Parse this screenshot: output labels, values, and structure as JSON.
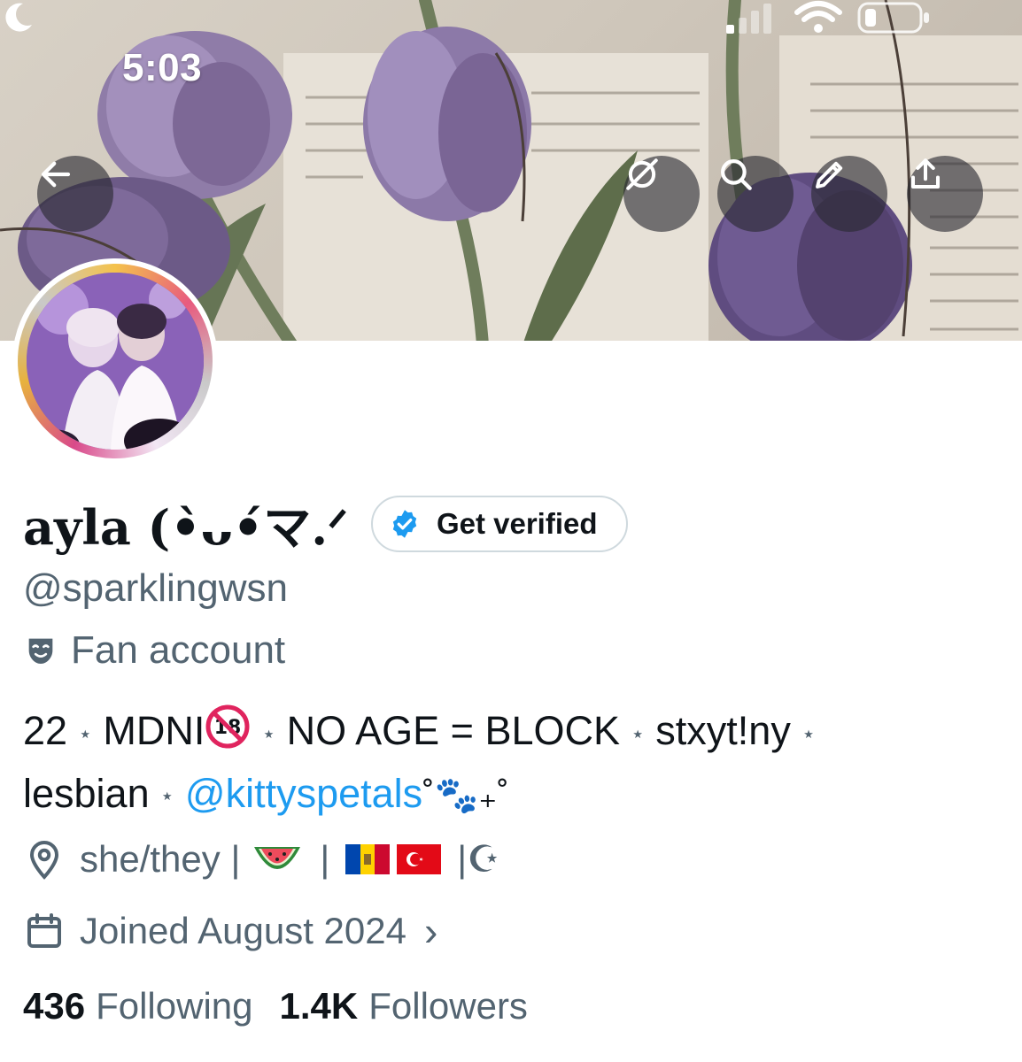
{
  "status_bar": {
    "time": "5:03"
  },
  "banner": {
    "description_icon": "tulips-on-book-photo"
  },
  "nav": {
    "back_icon": "arrow-left-icon",
    "actions": [
      "hide-icon",
      "search-icon",
      "edit-pencil-icon",
      "share-icon"
    ]
  },
  "profile": {
    "display_name": "ayla (•̀ᴗ•́マ.ᐟ",
    "get_verified_label": "Get verified",
    "handle": "@sparklingwsn",
    "category": "Fan account"
  },
  "bio": {
    "age": "22",
    "mdni": "MDNI",
    "rule": "NO AGE = BLOCK",
    "stan": "stxyt!ny",
    "orientation": "lesbian",
    "mention": "@kittyspetals",
    "deco": "˚🐾₊˚",
    "separator": "⋆"
  },
  "location": {
    "pronouns": "she/they |",
    "sep": "|",
    "crescent": "|☪"
  },
  "joined": {
    "label": "Joined August 2024",
    "chevron": "›"
  },
  "stats": {
    "following_count": "436",
    "following_label": "Following",
    "followers_count": "1.4K",
    "followers_label": "Followers"
  },
  "colors": {
    "accent": "#1d9bf0",
    "secondary_text": "#536471",
    "primary_text": "#0f1419",
    "border": "#cfd9de"
  }
}
